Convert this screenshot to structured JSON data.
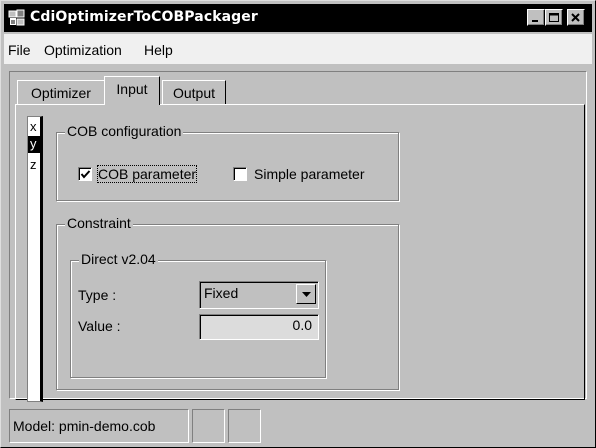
{
  "window": {
    "title": "CdiOptimizerToCOBPackager",
    "icon": "app-icon",
    "controls": {
      "minimize": "minimize-icon",
      "maximize": "maximize-icon",
      "close": "close-icon"
    }
  },
  "menu": {
    "items": [
      {
        "label": "File"
      },
      {
        "label": "Optimization"
      },
      {
        "label": "Help"
      }
    ]
  },
  "tabs": [
    {
      "label": "Optimizer",
      "active": false
    },
    {
      "label": "Input",
      "active": true
    },
    {
      "label": "Output",
      "active": false
    }
  ],
  "axes": {
    "items": [
      {
        "label": "x",
        "selected": false
      },
      {
        "label": "y",
        "selected": true
      },
      {
        "label": "z",
        "selected": false
      }
    ]
  },
  "cob_config": {
    "title": "COB configuration",
    "cob_parameter": {
      "label": "COB parameter",
      "checked": true
    },
    "simple_parameter": {
      "label": "Simple parameter",
      "checked": false
    }
  },
  "constraint": {
    "title": "Constraint",
    "direct": {
      "title": "Direct v2.04",
      "type_label": "Type :",
      "type_value": "Fixed",
      "value_label": "Value :",
      "value": "0.0"
    }
  },
  "status": {
    "model": "Model: pmin-demo.cob",
    "cell2": "",
    "cell3": ""
  }
}
